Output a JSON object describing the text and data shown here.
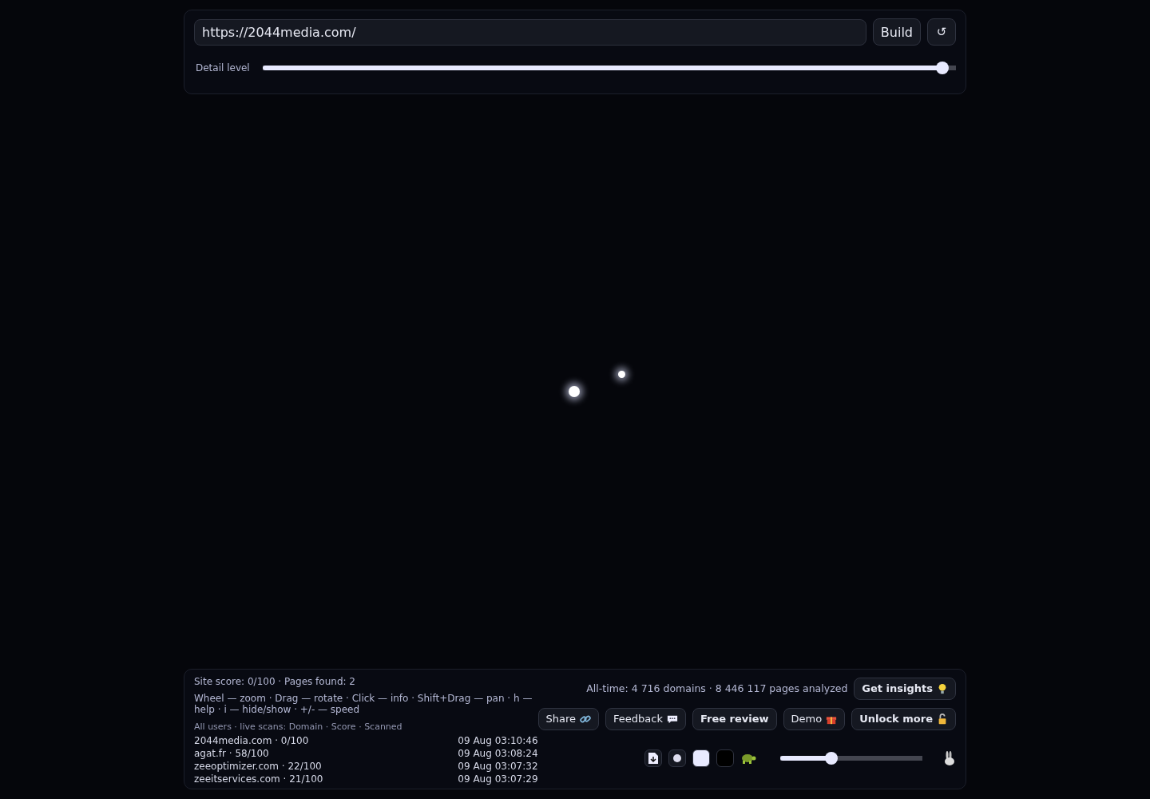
{
  "url_field": {
    "value": "https://2044media.com/"
  },
  "build_button": "Build",
  "reset_button": "↺",
  "detail": {
    "label": "Detail level",
    "level": 0.98
  },
  "info": {
    "score_line": "Site score: 0/100 · Pages found: 2",
    "help": "Wheel — zoom · Drag — rotate · Click — info · Shift+Drag — pan · h — help · i — hide/show · +/- — speed",
    "scans_header": "All users · live scans: Domain · Score · Scanned",
    "scans": [
      {
        "domain": "2044media.com · 0/100",
        "time": "09 Aug 03:10:46"
      },
      {
        "domain": "agat.fr · 58/100",
        "time": "09 Aug 03:08:24"
      },
      {
        "domain": "zeeoptimizer.com · 22/100",
        "time": "09 Aug 03:07:32"
      },
      {
        "domain": "zeeitservices.com · 21/100",
        "time": "09 Aug 03:07:29"
      }
    ]
  },
  "stats": "All-time: 4 716 domains · 8 446 117 pages analyzed",
  "buttons": [
    {
      "label": "Get insights",
      "kind": "strong"
    },
    {
      "label": "Share",
      "kind": "plain"
    },
    {
      "label": "Feedback",
      "kind": "plain"
    },
    {
      "label": "Free review",
      "kind": "strong"
    },
    {
      "label": "Demo",
      "kind": "plain"
    },
    {
      "label": "Unlock more",
      "kind": "strong"
    }
  ],
  "swatches": [
    {
      "color": "#e8eaff"
    },
    {
      "color": "#000000"
    }
  ],
  "speed": {
    "level": 0.36
  }
}
